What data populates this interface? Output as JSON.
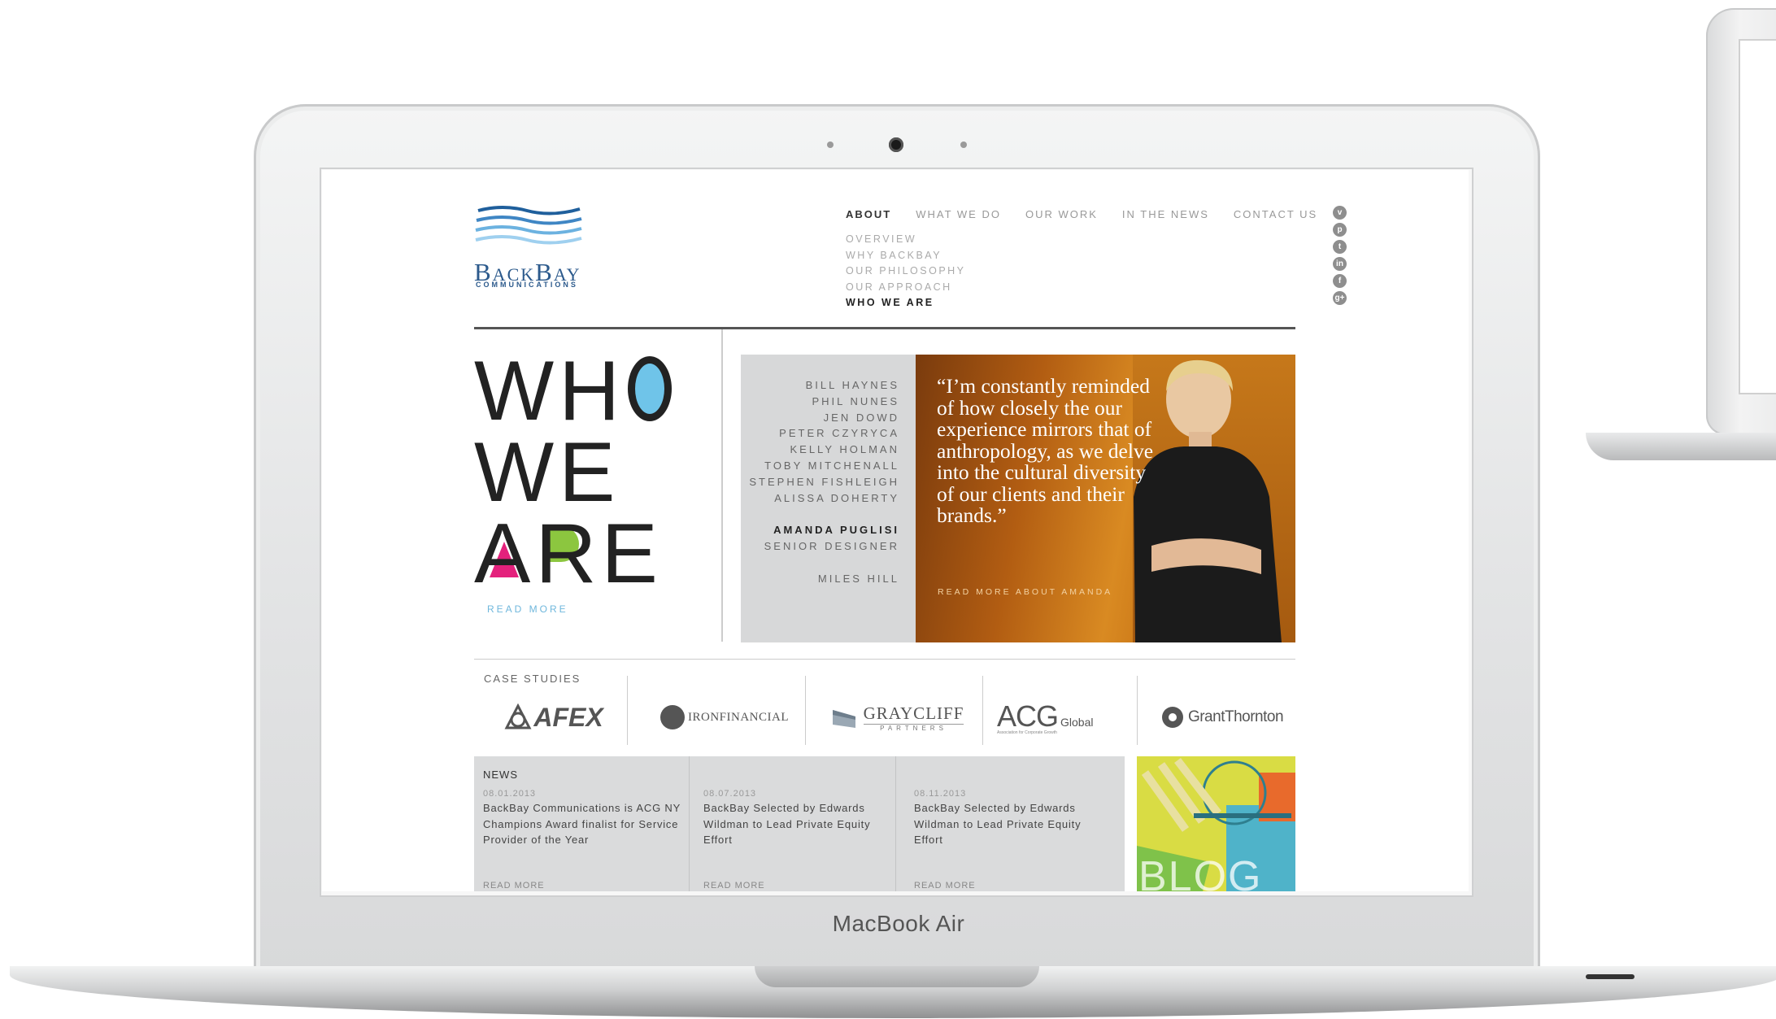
{
  "device": {
    "label": "MacBook Air"
  },
  "site": {
    "logo": {
      "name": "BackBay",
      "sub": "COMMUNICATIONS"
    },
    "nav": [
      {
        "label": "ABOUT",
        "active": true
      },
      {
        "label": "WHAT WE DO",
        "active": false
      },
      {
        "label": "OUR WORK",
        "active": false
      },
      {
        "label": "IN THE NEWS",
        "active": false
      },
      {
        "label": "CONTACT US",
        "active": false
      }
    ],
    "subnav": [
      {
        "label": "OVERVIEW",
        "active": false
      },
      {
        "label": "WHY BACKBAY",
        "active": false
      },
      {
        "label": "OUR PHILOSOPHY",
        "active": false
      },
      {
        "label": "OUR APPROACH",
        "active": false
      },
      {
        "label": "WHO WE ARE",
        "active": true
      }
    ],
    "social": [
      "vimeo-icon",
      "pinterest-icon",
      "twitter-icon",
      "linkedin-icon",
      "facebook-icon",
      "google-plus-icon"
    ],
    "hero": {
      "line1": "WH",
      "line2": "WE",
      "line3_a": "A",
      "line3_rest": "RE",
      "read_more": "READ MORE"
    },
    "team": {
      "members": [
        "BILL HAYNES",
        "PHIL NUNES",
        "JEN DOWD",
        "PETER CZYRYCA",
        "KELLY HOLMAN",
        "TOBY MITCHENALL",
        "STEPHEN FISHLEIGH",
        "ALISSA DOHERTY"
      ],
      "featured_name": "AMANDA PUGLISI",
      "featured_role": "SENIOR DESIGNER",
      "last_member": "MILES HILL"
    },
    "quote": {
      "text": "“I’m constantly reminded of how closely the our experience mirrors that of anthropology, as we delve into the cultural diversity of our clients and their brands.”",
      "read_more": "READ MORE ABOUT AMANDA"
    },
    "case_studies": {
      "label": "CASE STUDIES",
      "logos": [
        {
          "name": "AFEX"
        },
        {
          "name": "IRONFINANCIAL"
        },
        {
          "name": "GRAYCLIFF",
          "sub": "PARTNERS"
        },
        {
          "name": "ACG",
          "sub": "Global",
          "tagline": "Association for Corporate Growth"
        },
        {
          "name": "GrantThornton"
        }
      ]
    },
    "news": {
      "label": "NEWS",
      "items": [
        {
          "date": "08.01.2013",
          "title": "BackBay Communications is ACG NY Champions Award finalist for Service Provider of the Year",
          "read_more": "READ MORE"
        },
        {
          "date": "08.07.2013",
          "title": "BackBay Selected by Edwards Wildman to Lead Private Equity Effort",
          "read_more": "READ MORE"
        },
        {
          "date": "08.11.2013",
          "title": "BackBay Selected by Edwards Wildman to Lead Private Equity Effort",
          "read_more": "READ MORE"
        }
      ]
    },
    "blog": {
      "label": "BLOG"
    }
  }
}
